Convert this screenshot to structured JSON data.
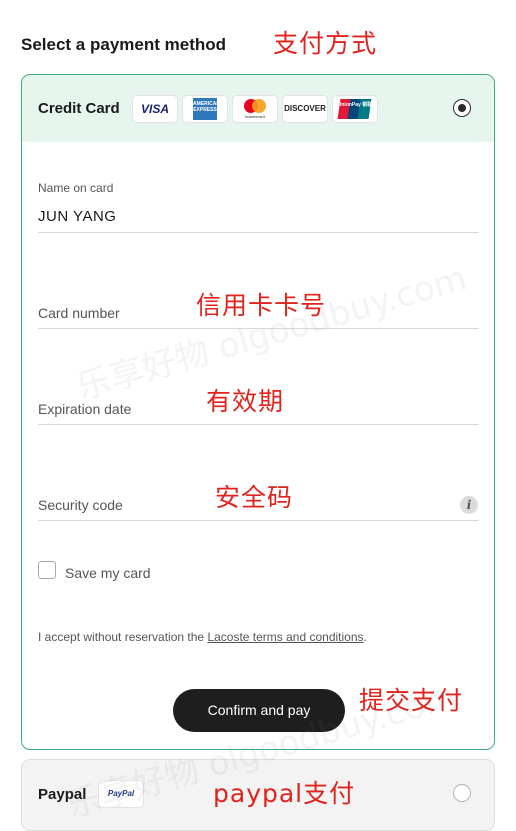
{
  "page": {
    "title": "Select a payment method"
  },
  "annotations": {
    "payment_method": "支付方式",
    "card_number": "信用卡卡号",
    "expiration": "有效期",
    "security": "安全码",
    "submit": "提交支付",
    "paypal": "paypal支付"
  },
  "watermark": {
    "text_top": "乐享好物 olgoodbuy.com",
    "text_bottom": "乐享好物 olgoodbuy.com"
  },
  "credit_card": {
    "label": "Credit Card",
    "selected": true,
    "logos": [
      "VISA",
      "AMERICAN EXPRESS",
      "mastercard",
      "DISCOVER",
      "UnionPay 银联"
    ],
    "fields": {
      "name_label": "Name on card",
      "name_value": "JUN YANG",
      "card_number_placeholder": "Card number",
      "expiration_placeholder": "Expiration date",
      "security_placeholder": "Security code",
      "info_glyph": "i"
    },
    "save_card_label": "Save my card",
    "save_card_checked": false,
    "terms_prefix": "I accept without reservation the ",
    "terms_link": "Lacoste terms and conditions",
    "terms_suffix": ".",
    "confirm_button": "Confirm and pay"
  },
  "paypal": {
    "label": "Paypal",
    "logo": "PayPal",
    "selected": false
  },
  "colors": {
    "accent": "#3fae7a",
    "header_bg": "#e6f5ee",
    "annotation": "#e0231c",
    "button_bg": "#1e1e1e"
  },
  "icons": [
    "radio-selected-icon",
    "info-icon",
    "radio-unselected-icon",
    "checkbox-icon"
  ]
}
